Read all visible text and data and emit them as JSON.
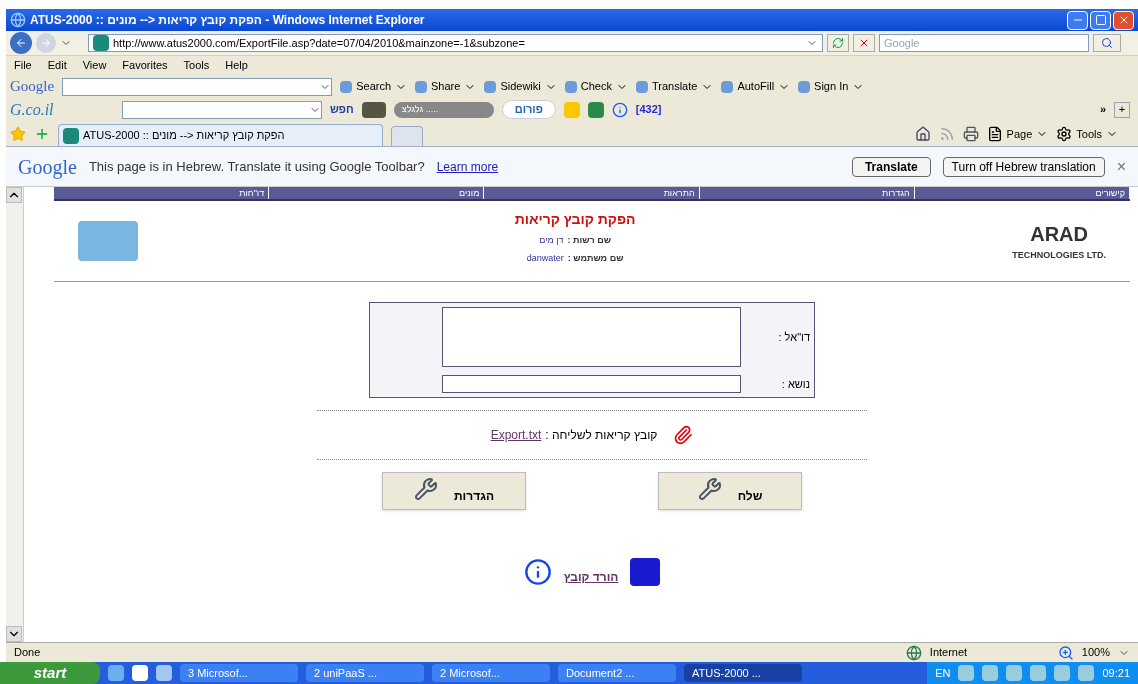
{
  "window": {
    "title": "ATUS-2000 :: הפקת קובץ קריאות <-- מונים - Windows Internet Explorer"
  },
  "address_bar": {
    "url": "http://www.atus2000.com/ExportFile.asp?date=07/04/2010&mainzone=-1&subzone=",
    "search_placeholder": "Google"
  },
  "menu": [
    "Help",
    "Tools",
    "Favorites",
    "View",
    "Edit",
    "File"
  ],
  "google_toolbar": {
    "logo": "Google",
    "items": [
      "Sign In",
      "AutoFill",
      "Translate",
      "Check",
      "Sidewiki",
      "Share",
      "Search"
    ]
  },
  "gcoil_toolbar": {
    "logo": "G.co.il",
    "search_label": "חפש",
    "radio": "גלגלצ .....",
    "forum": "פורום",
    "count": "[432]",
    "more": "»",
    "add": "+"
  },
  "tabs": [
    {
      "label": "ATUS-2000 :: הפקת קובץ קריאות <-- מונים",
      "selected": true
    }
  ],
  "command_bar": [
    "Tools",
    "Page"
  ],
  "translate_bar": {
    "logo": "Google",
    "message": "This page is in Hebrew.  Translate it using Google Toolbar?",
    "link": "Learn more",
    "buttons": [
      "Turn off Hebrew translation",
      "Translate"
    ],
    "close": "×"
  },
  "nav": [
    "קישורים",
    "הגדרות",
    "התראות",
    "מונים",
    "דו\"חות"
  ],
  "header": {
    "title": "הפקת קובץ קריאות",
    "fields": [
      {
        "label": "שם רשות :",
        "value": "דן מים"
      },
      {
        "label": "שם משתמש :",
        "value": "danwater"
      }
    ],
    "logo": "ARAD",
    "logo_sub": "TECHNOLOGIES LTD."
  },
  "form": {
    "email_label": "דו\"אל :",
    "subject_label": "נושא :"
  },
  "attachment": {
    "label": "קובץ קריאות לשליחה :",
    "file": "Export.txt"
  },
  "buttons": [
    "שלח",
    "הגדרות"
  ],
  "download": "הורד קובץ",
  "status_bar": {
    "text": "Done",
    "zone": "Internet",
    "zoom": "100%"
  },
  "taskbar": {
    "start": "start",
    "items": [
      {
        "label": "ATUS-2000 ...",
        "selected": true
      },
      {
        "label": "Document2 ...",
        "selected": false
      },
      {
        "label": "2 Microsof...",
        "selected": false
      },
      {
        "label": "2 uniPaaS ...",
        "selected": false
      },
      {
        "label": "3 Microsof...",
        "selected": false
      }
    ],
    "lang": "EN",
    "clock": "09:21"
  }
}
